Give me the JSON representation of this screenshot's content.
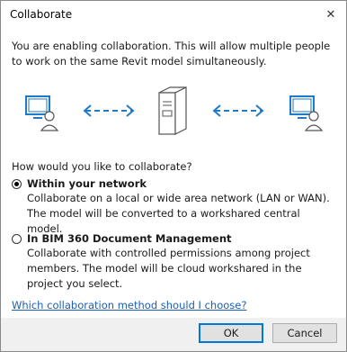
{
  "window": {
    "title": "Collaborate",
    "close_glyph": "✕"
  },
  "intro": "You are enabling collaboration. This will allow multiple people to work on the same Revit model simultaneously.",
  "question": "How would you like to collaborate?",
  "options": [
    {
      "label": "Within your network",
      "desc": "Collaborate on a local or wide area network (LAN or WAN). The model will be converted to a workshared central model.",
      "selected": true
    },
    {
      "label": "In BIM 360 Document Management",
      "desc": "Collaborate with controlled permissions among project members. The model will be cloud workshared in the project you select.",
      "selected": false
    }
  ],
  "help_link": "Which collaboration method should I choose?",
  "buttons": {
    "ok": "OK",
    "cancel": "Cancel"
  },
  "colors": {
    "link": "#1a5fb4",
    "icon_blue": "#1f7ac8",
    "accent": "#0078d7"
  },
  "icons": [
    "user-computer-icon",
    "bidirectional-arrow-icon",
    "server-icon",
    "bidirectional-arrow-icon",
    "user-computer-icon"
  ]
}
